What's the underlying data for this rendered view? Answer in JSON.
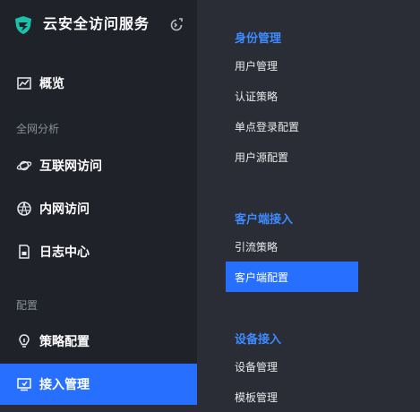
{
  "brand": {
    "name": "云安全访问服务",
    "logo_icon": "shield-logo-icon",
    "collapse_icon": "collapse-icon"
  },
  "sidebar": {
    "items": [
      {
        "label": "概览",
        "icon": "chart-icon"
      },
      {
        "label": "互联网访问",
        "icon": "planet-icon"
      },
      {
        "label": "内网访问",
        "icon": "network-icon"
      },
      {
        "label": "日志中心",
        "icon": "file-icon"
      },
      {
        "label": "策略配置",
        "icon": "bulb-icon"
      },
      {
        "label": "接入管理",
        "icon": "monitor-icon"
      }
    ],
    "groups": [
      "全网分析",
      "配置"
    ]
  },
  "submenu": {
    "sections": [
      {
        "title": "身份管理",
        "items": [
          "用户管理",
          "认证策略",
          "单点登录配置",
          "用户源配置"
        ]
      },
      {
        "title": "客户端接入",
        "items": [
          "引流策略",
          "客户端配置"
        ]
      },
      {
        "title": "设备接入",
        "items": [
          "设备管理",
          "模板管理"
        ]
      }
    ]
  },
  "colors": {
    "accent": "#2770ff",
    "section_title": "#3d8bff",
    "sidebar_bg": "#1f2229",
    "panel_bg": "#2a2d36"
  }
}
